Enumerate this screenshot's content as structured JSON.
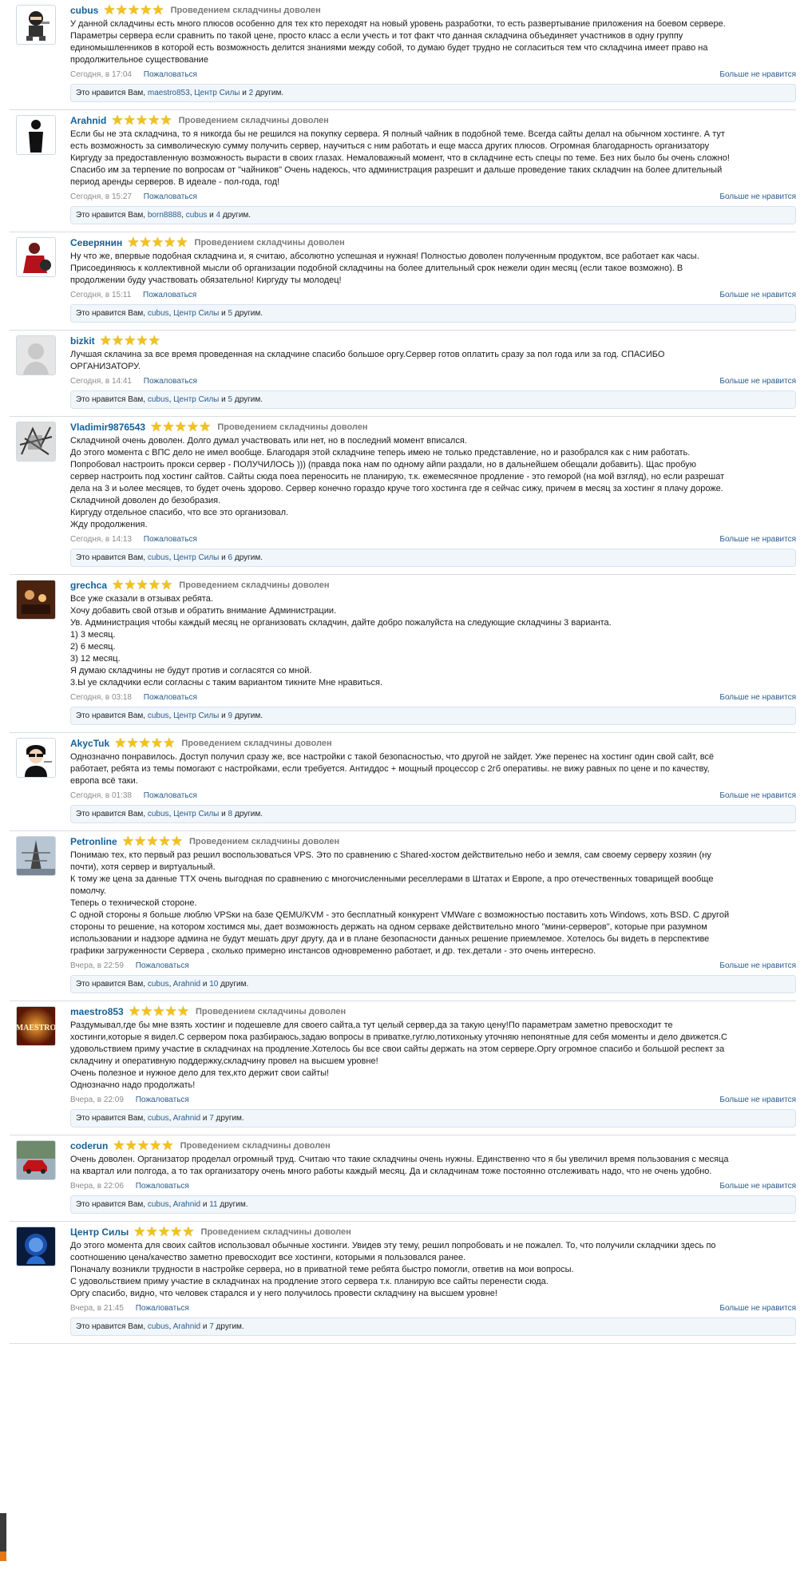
{
  "ui": {
    "badge_text": "Проведением складчины доволен",
    "report_label": "Пожаловаться",
    "unlike_label": "Больше не нравится",
    "likes_prefix": "Это нравится Вам, ",
    "likes_and": " и ",
    "likes_suffix": " другим.",
    "comma": ", ",
    "colors": {
      "link": "#176093",
      "star": "#f3c21a",
      "likes_bg": "#f1f6fb"
    }
  },
  "reviews": [
    {
      "author": "cubus",
      "avatar_icon": "ninja-avatar-icon",
      "rating": 5,
      "show_badge": true,
      "text": "У данной складчины есть много плюсов особенно для тех кто переходят на новый уровень разработки, то есть развертывание приложения на боевом сервере.\nПараметры сервера если сравнить по такой цене, просто класс а если учесть и тот факт что данная складчина объединяет участников в одну группу\nединомышленников в которой есть возможность делится знаниями между собой, то думаю будет трудно не согласиться тем что складчина имеет право на\nпродолжительное существование",
      "date": "Сегодня, в 17:04",
      "likers": [
        "maestro853",
        "Центр Силы"
      ],
      "others": "2"
    },
    {
      "author": "Arahnid",
      "avatar_icon": "silhouette-man-avatar-icon",
      "rating": 5,
      "show_badge": true,
      "text": "Если бы не эта складчина, то я никогда бы не решился на покупку сервера. Я полный чайник в подобной теме. Всегда сайты делал на обычном хостинге. А тут\nесть возможность за символическую сумму получить сервер, научиться с ним работать и еще масса других плюсов. Огромная благодарность организатору\nКиргуду за предоставленную возможность вырасти в своих глазах. Немаловажный момент, что в складчине есть спецы по теме. Без них было бы очень сложно!\nСпасибо им за терпение по вопросам от \"чайников\" Очень надеюсь, что администрация разрешит и дальше проведение таких складчин на более длительный\nпериод аренды серверов. В идеале - пол-года, год!",
      "date": "Сегодня, в 15:27",
      "likers": [
        "born8888",
        "cubus"
      ],
      "others": "4"
    },
    {
      "author": "Северянин",
      "avatar_icon": "red-character-avatar-icon",
      "rating": 5,
      "show_badge": true,
      "text": "Ну что же, впервые подобная складчина и, я считаю, абсолютно успешная и нужная! Полностью доволен полученным продуктом, все работает как часы.\nПрисоединяюсь к коллективной мысли об организации подобной складчины на более длительный срок нежели один месяц (если такое возможно). В\nпродолжении буду участвовать обязательно! Киргуду ты молодец!",
      "date": "Сегодня, в 15:11",
      "likers": [
        "cubus",
        "Центр Силы"
      ],
      "others": "5"
    },
    {
      "author": "bizkit",
      "avatar_icon": "default-user-avatar-icon",
      "rating": 5,
      "show_badge": false,
      "text": "Лучшая склачина за все время проведенная на складчине спасибо большое оргу.Сервер готов оплатить сразу за пол года или за год. СПАСИБО\nОРГАНИЗАТОРУ.",
      "date": "Сегодня, в 14:41",
      "likers": [
        "cubus",
        "Центр Силы"
      ],
      "others": "5"
    },
    {
      "author": "Vladimir9876543",
      "avatar_icon": "sketch-avatar-icon",
      "rating": 5,
      "show_badge": true,
      "text": "Складчиной очень доволен. Долго думал участвовать или нет, но в последний момент вписался.\nДо этого момента с ВПС дело не имел вообще. Благодаря этой складчине теперь имею не только представление, но и разобрался как с ним работать.\nПопробовал настроить прокси сервер - ПОЛУЧИЛОСЬ ))) (правда пока нам по одному айпи раздали, но в дальнейшем обещали добавить). Щас пробую\nсервер настроить под хостинг сайтов. Сайты сюда поеа переносить не планирую, т.к. ежемесячное продление - это геморой (на мой взгляд), но если разрешат\nдела на 3 и ьолее месяцев, то будет очень здорово. Сервер конечно гораздо круче того хостинга где я сейчас сижу, причем в месяц за хостинг я плачу дороже.\nСкладчиной доволен до безобразия.\nКиргуду отдельное спасибо, что все это организовал.\nЖду продолжения.",
      "date": "Сегодня, в 14:13",
      "likers": [
        "cubus",
        "Центр Силы"
      ],
      "others": "6"
    },
    {
      "author": "grechca",
      "avatar_icon": "cafe-photo-avatar-icon",
      "rating": 5,
      "show_badge": true,
      "text": "Все уже сказали в отзывах ребята.\nХочу добавить свой отзыв и обратить внимание Администрации.\nУв. Администрация чтобы каждый месяц не организовать складчин, дайте добро пожалуйста на следующие складчины 3 варианта.\n1) 3 месяц.\n2) 6 месяц.\n3) 12 месяц.\nЯ думаю складчины не будут против и согласятся со мной.\n3.Ы уе складчики если согласны с таким вариантом тикните Мне нравиться.",
      "date": "Сегодня, в 03:18",
      "likers": [
        "cubus",
        "Центр Силы"
      ],
      "others": "9"
    },
    {
      "author": "AkycTuk",
      "avatar_icon": "sunglasses-man-avatar-icon",
      "rating": 5,
      "show_badge": true,
      "text": "Однозначно понравилось. Доступ получил сразу же, все настройки с такой безопасностью, что другой не зайдет. Уже перенес на хостинг один свой сайт, всё\nработает, ребята из темы помогают с настройками, если требуется. Антиддос + мощный процессор с 2гб оперативы. не вижу равных по цене и по качеству,\nевропа всё таки.",
      "date": "Сегодня, в 01:38",
      "likers": [
        "cubus",
        "Центр Силы"
      ],
      "others": "8"
    },
    {
      "author": "Petronline",
      "avatar_icon": "tower-photo-avatar-icon",
      "rating": 5,
      "show_badge": true,
      "text": "Понимаю тех, кто первый раз решил воспользоваться VPS. Это по сравнению с Shared-хостом действительно небо и земля, сам своему серверу хозяин (ну\nпочти), хотя сервер и виртуальный.\nК тому же цена за данные ТТХ очень выгодная по сравнению с многочисленными реселлерами в Штатах и Европе, а про отечественных товарищей вообще\nпомолчу.\nТеперь о технической стороне.\nС одной стороны я больше люблю VPSки на базе QEMU/KVM - это бесплатный конкурент VMWare с возможностью поставить хоть Windows, хоть BSD. С другой\nстороны то решение, на котором хостимся мы, дает возможность держать на одном серваке действительно много \"мини-серверов\", которые при разумном\nиспользовании и надзоре админа не будут мешать друг другу, да и в плане безопасности данных решение приемлемое. Хотелось бы видеть в перспективе\nграфики загруженности Сервера , сколько примерно инстансов одновременно работает, и др. тех.детали - это очень интересно.",
      "date": "Вчера, в 22:59",
      "likers": [
        "cubus",
        "Arahnid"
      ],
      "others": "10"
    },
    {
      "author": "maestro853",
      "avatar_icon": "maestro-logo-avatar-icon",
      "avatar_text": "MAESTRO",
      "rating": 5,
      "show_badge": true,
      "text": "Раздумывал,где бы мне взять хостинг и подешевле для своего сайта,а тут целый сервер,да за такую цену!По параметрам заметно превосходит те\nхостинги,которые я видел.С сервером пока разбираюсь,задаю вопросы в приватке,гуглю,потихоньку уточняю непонятные для себя моменты и дело движется.С\nудовольствием приму участие в складчинах на продление.Хотелось бы все свои сайты держать на этом сервере.Оргу огромное спасибо и большой респект за\nскладчину и оперативную поддержку,складчину провел на высшем уровне!\nОчень полезное и нужное дело для тех,кто держит свои сайты!\nОднозначно надо продолжать!",
      "date": "Вчера, в 22:09",
      "likers": [
        "cubus",
        "Arahnid"
      ],
      "others": "7"
    },
    {
      "author": "coderun",
      "avatar_icon": "red-car-avatar-icon",
      "rating": 5,
      "show_badge": true,
      "text": "Очень доволен. Организатор проделал огромный труд. Считаю что такие складчины очень нужны. Единственно что я бы увеличил время пользования с месяца\nна квартал или полгода, а то так организатору очень много работы каждый месяц. Да и складчинам тоже постоянно отслеживать надо, что не очень удобно.",
      "date": "Вчера, в 22:06",
      "likers": [
        "cubus",
        "Arahnid"
      ],
      "others": "11"
    },
    {
      "author": "Центр Силы",
      "avatar_icon": "blue-head-avatar-icon",
      "rating": 5,
      "show_badge": true,
      "text": "До этого момента для своих сайтов использовал обычные хостинги. Увидев эту тему, решил попробовать и не пожалел. То, что получили складчики здесь по\nсоотношению цена/качество заметно превосходит все хостинги, которыми я пользовался ранее.\nПоначалу возникли трудности в настройке сервера, но в приватной теме ребята быстро помогли, ответив на мои вопросы.\nС удовольствием приму участие в складчинах на продление этого сервера т.к. планирую все сайты перенести сюда.\nОргу спасибо, видно, что человек старался и у него получилось провести складчину на высшем уровне!",
      "date": "Вчера, в 21:45",
      "likers": [
        "cubus",
        "Arahnid"
      ],
      "others": "7"
    }
  ]
}
